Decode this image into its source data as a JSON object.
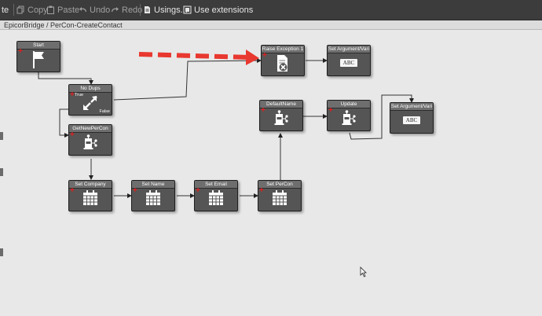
{
  "toolbar": {
    "partial_label": "te",
    "copy_label": "Copy",
    "paste_label": "Paste",
    "undo_label": "Undo",
    "redo_label": "Redo",
    "usings_label": "Usings...",
    "extensions_label": "Use extensions"
  },
  "breadcrumb": "EpicorBridge / PerCon-CreateContact",
  "activities": {
    "start": "Start",
    "no_dups": "No Dups",
    "no_dups_true": "True",
    "no_dups_false": "False",
    "get_new_per_con": "GetNewPerCon",
    "raise_exception": "Raise Exception 1",
    "set_argument_1": "Set Argument/Vari",
    "default_name": "DefaultName",
    "update": "Update",
    "set_argument_2": "Set Argument/Vari",
    "set_company": "Set Company",
    "set_name": "Set Name",
    "set_email": "Set Email",
    "set_per_con": "Set PerCon",
    "abc": "ABC"
  },
  "colors": {
    "toolbar_bg": "#3c3c3c",
    "canvas_bg": "#e8e8e8",
    "activity_bg": "#555555",
    "plus_red": "#e21b1b",
    "annotation_arrow": "#e8382f"
  },
  "icons": {
    "start": "flag-icon",
    "decision": "diagonal-arrows-icon",
    "method": "method-call-icon",
    "exception": "document-error-icon",
    "set_field": "calendar-grid-icon",
    "argument": "abc-icon"
  }
}
